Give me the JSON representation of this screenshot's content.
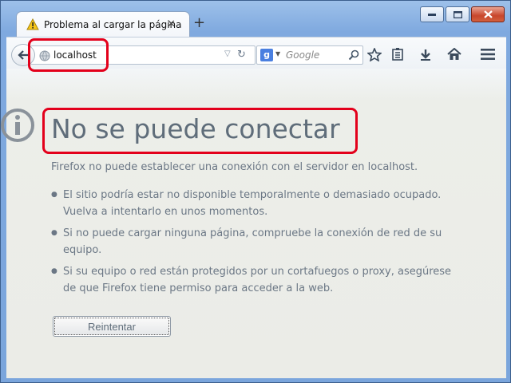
{
  "window": {
    "tab_title": "Problema al cargar la página",
    "tab_close": "✕",
    "new_tab": "+"
  },
  "toolbar": {
    "url": "localhost",
    "search_engine": "g",
    "search_placeholder": "Google",
    "icons": [
      "back-icon",
      "globe-icon",
      "reload-icon",
      "search-icon",
      "bookmark-star-icon",
      "reading-list-icon",
      "download-icon",
      "home-icon",
      "menu-icon"
    ]
  },
  "error": {
    "heading": "No se puede conectar",
    "description": "Firefox no puede establecer una conexión con el servidor en localhost.",
    "bullets": [
      "El sitio podría estar no disponible temporalmente o demasiado ocupado. Vuelva a intentarlo en unos momentos.",
      "Si no puede cargar ninguna página, compruebe la conexión de red de su equipo.",
      "Si su equipo o red están protegidos por un cortafuegos o proxy, asegúrese de que Firefox tiene permiso para acceder a la web."
    ],
    "retry_label": "Reintentar"
  },
  "colors": {
    "highlight": "#e3001b",
    "heading": "#5f6d7a",
    "body_text": "#6b7785"
  }
}
